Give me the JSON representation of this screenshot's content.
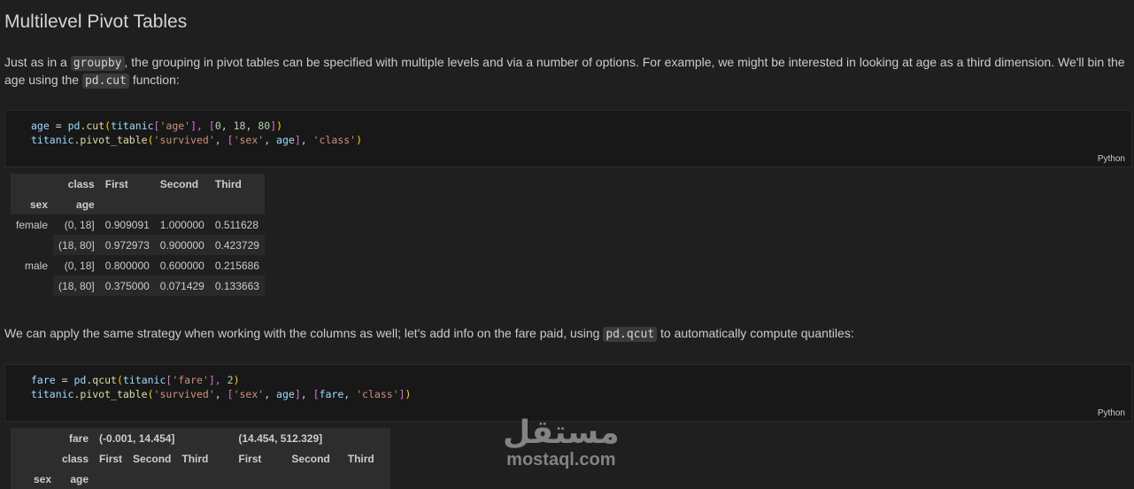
{
  "heading": "Multilevel Pivot Tables",
  "para1": {
    "t1": "Just as in a ",
    "c1": "groupby",
    "t2": ", the grouping in pivot tables can be specified with multiple levels and via a number of options. For example, we might be interested in looking at age as a third dimension. We'll bin the age using the ",
    "c2": "pd.cut",
    "t3": " function:"
  },
  "cell1": {
    "lang": "Python",
    "line1": [
      "age",
      " = ",
      "pd",
      ".",
      "cut",
      "(",
      "titanic",
      "[",
      "'age'",
      "], ",
      "[",
      "0",
      ", ",
      "18",
      ", ",
      "80",
      "]",
      ")"
    ],
    "line2": [
      "titanic",
      ".",
      "pivot_table",
      "(",
      "'survived'",
      ", ",
      "[",
      "'sex'",
      ", ",
      "age",
      "]",
      ", ",
      "'class'",
      ")"
    ]
  },
  "table1": {
    "col_header_name": "class",
    "columns": [
      "First",
      "Second",
      "Third"
    ],
    "index_names": [
      "sex",
      "age"
    ],
    "rows": [
      {
        "sex": "female",
        "age": "(0, 18]",
        "values": [
          "0.909091",
          "1.000000",
          "0.511628"
        ]
      },
      {
        "sex": "",
        "age": "(18, 80]",
        "values": [
          "0.972973",
          "0.900000",
          "0.423729"
        ]
      },
      {
        "sex": "male",
        "age": "(0, 18]",
        "values": [
          "0.800000",
          "0.600000",
          "0.215686"
        ]
      },
      {
        "sex": "",
        "age": "(18, 80]",
        "values": [
          "0.375000",
          "0.071429",
          "0.133663"
        ]
      }
    ]
  },
  "para2": {
    "t1": "We can apply the same strategy when working with the columns as well; let's add info on the fare paid, using ",
    "c1": "pd.qcut",
    "t2": " to automatically compute quantiles:"
  },
  "cell2": {
    "lang": "Python",
    "line1": [
      "fare",
      " = ",
      "pd",
      ".",
      "qcut",
      "(",
      "titanic",
      "[",
      "'fare'",
      "], ",
      "2",
      ")"
    ],
    "line2": [
      "titanic",
      ".",
      "pivot_table",
      "(",
      "'survived'",
      ", ",
      "[",
      "'sex'",
      ", ",
      "age",
      "]",
      ", ",
      "[",
      "fare",
      ", ",
      "'class'",
      "]",
      ")"
    ]
  },
  "table2": {
    "top_header_name": "fare",
    "fare_bins": [
      "(-0.001, 14.454]",
      "(14.454, 512.329]"
    ],
    "col_header_name": "class",
    "columns": [
      "First",
      "Second",
      "Third",
      "First",
      "Second",
      "Third"
    ],
    "index_names": [
      "sex",
      "age"
    ]
  },
  "watermark": {
    "arabic": "مستقل",
    "latin": "mostaql.com"
  }
}
